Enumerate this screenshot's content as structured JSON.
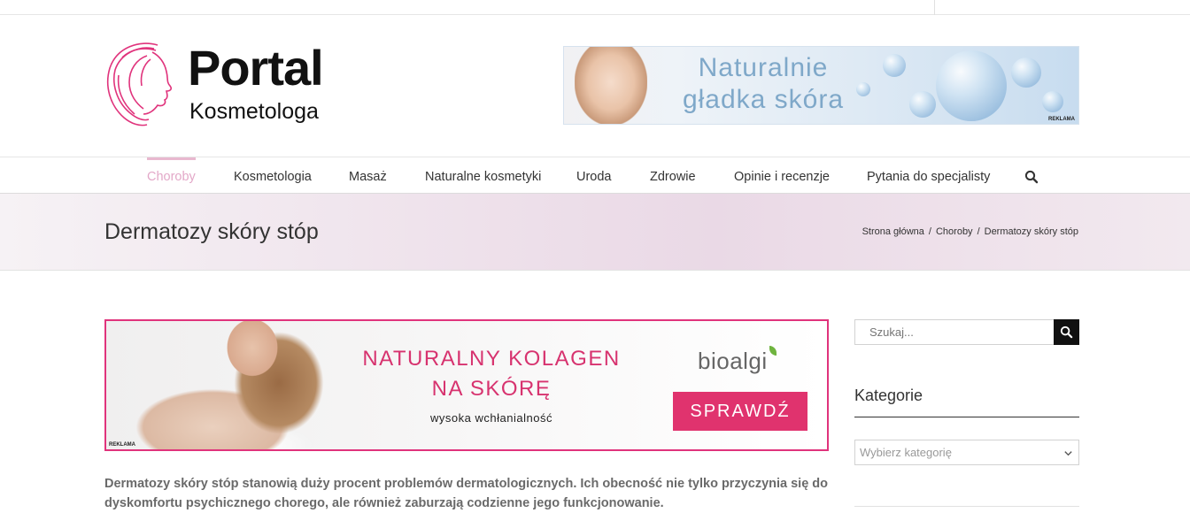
{
  "header": {
    "logo": {
      "title": "Portal",
      "subtitle": "Kosmetologa"
    },
    "top_ad": {
      "line1": "Naturalnie",
      "line2": "gładka skóra",
      "tag": "REKLAMA"
    }
  },
  "nav": {
    "items": [
      {
        "label": "Choroby",
        "active": true
      },
      {
        "label": "Kosmetologia"
      },
      {
        "label": "Masaż"
      },
      {
        "label": "Naturalne kosmetyki"
      },
      {
        "label": "Uroda"
      },
      {
        "label": "Zdrowie"
      },
      {
        "label": "Opinie i recenzje"
      },
      {
        "label": "Pytania do specjalisty"
      }
    ],
    "search_icon": "search-icon"
  },
  "page": {
    "title": "Dermatozy skóry stóp",
    "breadcrumbs": [
      "Strona główna",
      "Choroby",
      "Dermatozy skóry stóp"
    ],
    "breadcrumb_separator": "/"
  },
  "main_ad": {
    "headline1": "NATURALNY KOLAGEN",
    "headline2": "NA SKÓRĘ",
    "subline": "wysoka wchłanialność",
    "brand": "bioalgi",
    "cta": "SPRAWDŹ",
    "tag": "REKLAMA",
    "accent": "#e0336e"
  },
  "article": {
    "lead": "Dermatozy skóry stóp stanowią duży procent problemów dermatologicznych. Ich obecność nie tylko przyczynia się do dyskomfortu psychicznego chorego, ale również zaburzają codzienne jego funkcjonowanie."
  },
  "sidebar": {
    "search_placeholder": "Szukaj...",
    "categories_title": "Kategorie",
    "categories_select": "Wybierz kategorię"
  },
  "colors": {
    "brand_pink": "#e0337c",
    "nav_active": "#e3a8c8",
    "text": "#333333"
  }
}
